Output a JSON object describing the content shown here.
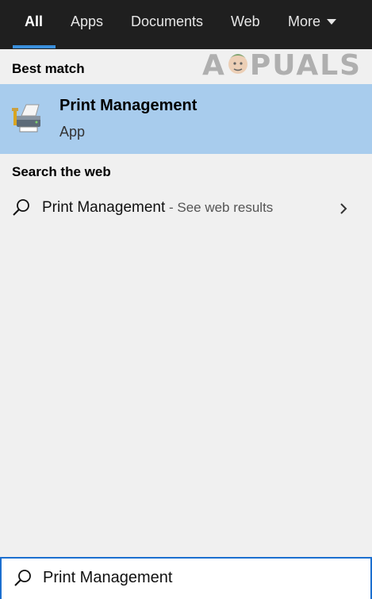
{
  "tabs": [
    {
      "label": "All",
      "active": true
    },
    {
      "label": "Apps"
    },
    {
      "label": "Documents"
    },
    {
      "label": "Web"
    },
    {
      "label": "More"
    }
  ],
  "watermark": {
    "text_left": "A",
    "text_right": "PUALS"
  },
  "best_match": {
    "section_title": "Best match",
    "app_name": "Print Management",
    "app_type": "App"
  },
  "web_search": {
    "section_title": "Search the web",
    "query": "Print Management",
    "suffix": " - See web results"
  },
  "search_box": {
    "value": "Print Management"
  },
  "colors": {
    "tab_bar": "#1f1f1f",
    "accent": "#3a8fdc",
    "selection": "#a8cced",
    "panel": "#f0f0f0"
  }
}
